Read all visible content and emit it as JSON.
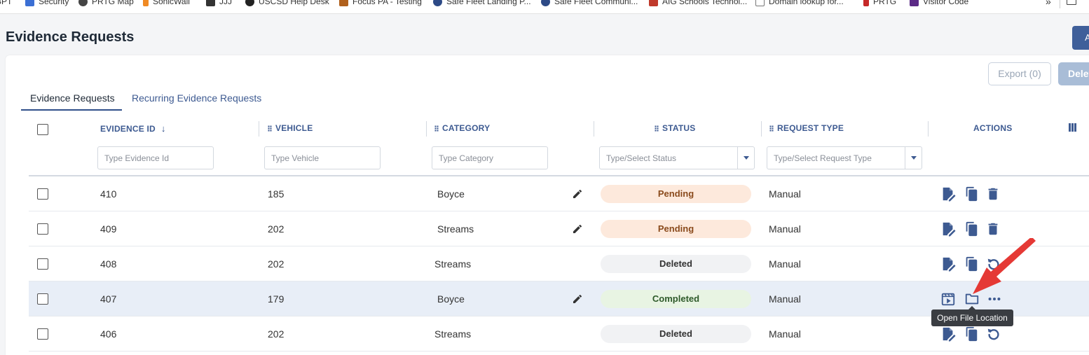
{
  "bookmarks": [
    "BPT",
    "Security",
    "PRTG Map",
    "SonicWall",
    "JJJ",
    "USCSD Help Desk",
    "Focus PA - Testing",
    "Safe Fleet Landing P...",
    "Safe Fleet Communi...",
    "AIG Schools Technol...",
    "Domain lookup for...",
    "PRTG",
    "Visitor Code"
  ],
  "page": {
    "title": "Evidence Requests",
    "top_button_label": "A"
  },
  "toolbar": {
    "export_label": "Export (0)",
    "delete_label": "Delete"
  },
  "tabs": [
    {
      "label": "Evidence Requests",
      "active": true
    },
    {
      "label": "Recurring Evidence Requests",
      "active": false
    }
  ],
  "columns": {
    "evidence_id": "EVIDENCE ID",
    "vehicle": "VEHICLE",
    "category": "CATEGORY",
    "status": "STATUS",
    "request_type": "REQUEST TYPE",
    "actions": "ACTIONS"
  },
  "filters": {
    "evidence_id": "Type Evidence Id",
    "vehicle": "Type Vehicle",
    "category": "Type Category",
    "status": "Type/Select Status",
    "request_type": "Type/Select Request Type"
  },
  "rows": [
    {
      "id": "410",
      "vehicle": "185",
      "category": "Boyce",
      "status": "Pending",
      "request_type": "Manual"
    },
    {
      "id": "409",
      "vehicle": "202",
      "category": "Streams",
      "status": "Pending",
      "request_type": "Manual"
    },
    {
      "id": "408",
      "vehicle": "202",
      "category": "Streams",
      "status": "Deleted",
      "request_type": "Manual"
    },
    {
      "id": "407",
      "vehicle": "179",
      "category": "Boyce",
      "status": "Completed",
      "request_type": "Manual"
    },
    {
      "id": "406",
      "vehicle": "202",
      "category": "Streams",
      "status": "Deleted",
      "request_type": "Manual"
    }
  ],
  "tooltip": "Open File Location",
  "colors": {
    "accent": "#3d5a91",
    "primary_button": "#3f5f9a",
    "arrow": "#e53935"
  }
}
